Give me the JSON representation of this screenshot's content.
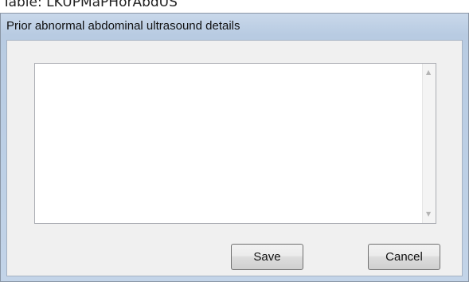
{
  "backdrop": {
    "caption": "Table: LKUPMaPHorAbdUS"
  },
  "dialog": {
    "title": "Prior abnormal abdominal ultrasound details",
    "details_field": {
      "value": "",
      "placeholder": ""
    },
    "save_label": "Save",
    "cancel_label": "Cancel"
  },
  "colors": {
    "frame": "#bdd0e6",
    "client_background": "#f0f0f0",
    "field_background": "#ffffff",
    "field_border": "#abadb3",
    "button_border": "#707070"
  },
  "icons": {
    "scroll_up": "scroll-up-arrow-icon",
    "scroll_down": "scroll-down-arrow-icon"
  }
}
